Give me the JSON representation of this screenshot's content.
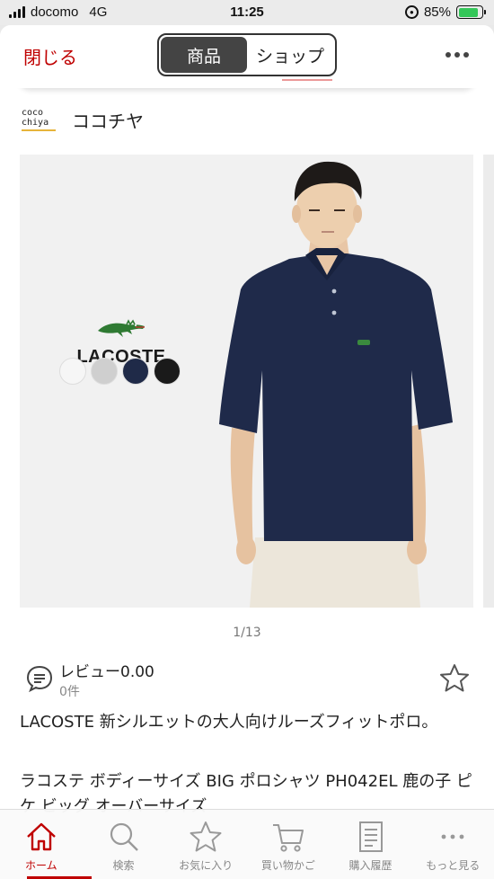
{
  "status_bar": {
    "carrier": "docomo",
    "network": "4G",
    "time": "11:25",
    "battery": "85%",
    "battery_level": 0.85
  },
  "top_bar": {
    "close_label": "閉じる",
    "segments": [
      {
        "label": "商品",
        "active": true
      },
      {
        "label": "ショップ",
        "active": false
      }
    ]
  },
  "shop": {
    "logo_line1": "coco",
    "logo_line2": "chiya",
    "name": "ココチヤ"
  },
  "product_image": {
    "brand_text": "LACOSTE",
    "swatch_colors": [
      "#f6f6f6",
      "#cfcfcf",
      "#1f2a48",
      "#1a1a1a"
    ],
    "shirt_color": "#1f2a4a",
    "pager": "1/13"
  },
  "review": {
    "title": "レビュー0.00",
    "count": "0件"
  },
  "product": {
    "title": "LACOSTE 新シルエットの大人向けルーズフィットポロ。",
    "subtitle": "ラコステ ボディーサイズ BIG ポロシャツ PH042EL 鹿の子 ピケ ビッグ オーバーサイズ"
  },
  "tab_bar": {
    "accent": "#bf0000",
    "tabs": [
      {
        "label": "ホーム",
        "icon": "home-icon",
        "active": true
      },
      {
        "label": "検索",
        "icon": "search-icon",
        "active": false
      },
      {
        "label": "お気に入り",
        "icon": "star-icon",
        "active": false
      },
      {
        "label": "買い物かご",
        "icon": "cart-icon",
        "active": false
      },
      {
        "label": "購入履歴",
        "icon": "receipt-icon",
        "active": false
      },
      {
        "label": "もっと見る",
        "icon": "more-icon",
        "active": false
      }
    ]
  }
}
